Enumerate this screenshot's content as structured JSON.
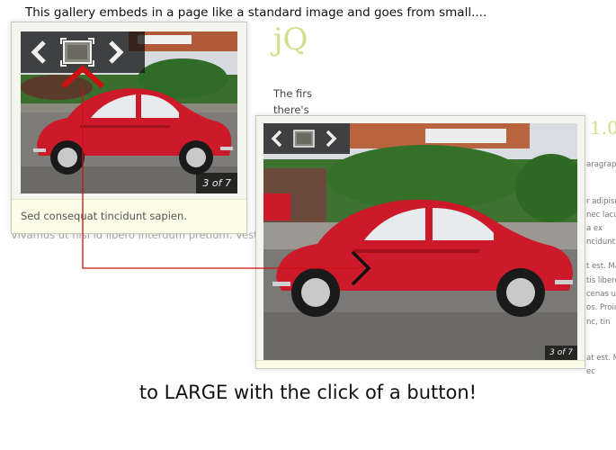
{
  "captions": {
    "top": "This gallery embeds in a page like a standard  image and goes from small....",
    "bottom": "to LARGE with the click of a button!"
  },
  "background_page": {
    "heading": "jQ",
    "heading_right": "1.0",
    "paragraph": "The firs there's",
    "overflow_text": "Vivamus ut nisl id libero interdum pretium. Vest",
    "right_column": [
      "aragraph",
      "r adipisc",
      "nec lacu",
      "a ex",
      "ncidunt",
      "t est. Ma",
      "tis libero",
      "cenas ult",
      "os. Proin",
      "nc, tin",
      "at est. M",
      "ec"
    ]
  },
  "small_gallery": {
    "counter": "3 of 7",
    "caption": "Sed consequat tincidunt sapien."
  },
  "large_gallery": {
    "counter": "3 of 7"
  },
  "icons": [
    "prev-arrow-icon",
    "fullscreen-icon",
    "next-arrow-icon"
  ],
  "colors": {
    "car_red": "#cc1a2a",
    "arrow_red": "#cc1111",
    "heading_green": "#cfe08a",
    "caption_bg": "#fcfde6"
  }
}
